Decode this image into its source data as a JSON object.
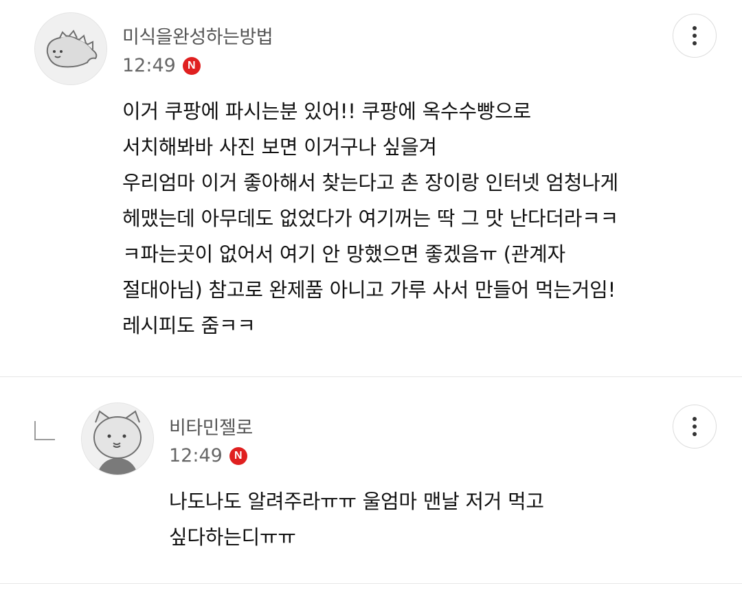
{
  "comments": [
    {
      "nickname": "미식을완성하는방법",
      "time": "12:49",
      "badge": "N",
      "avatar_icon": "dinosaur-avatar-icon",
      "lines": [
        "이거 쿠팡에 파시는분 있어!! 쿠팡에 옥수수빵으로",
        "서치해봐바 사진 보면 이거구나 싶을겨",
        "우리엄마 이거 좋아해서 찾는다고 촌 장이랑 인터넷 엄청나게",
        "헤맸는데 아무데도 없었다가 여기꺼는 딱 그 맛 난다더라ㅋㅋ",
        "ㅋ파는곳이 없어서 여기 안 망했으면 좋겠음ㅠ (관계자",
        "절대아님) 참고로 완제품 아니고 가루 사서 만들어 먹는거임!",
        "레시피도 줌ㅋㅋ"
      ]
    },
    {
      "nickname": "비타민젤로",
      "time": "12:49",
      "badge": "N",
      "avatar_icon": "cat-avatar-icon",
      "is_reply": true,
      "lines": [
        "나도나도 알려주라ㅠㅠ 울엄마 맨날 저거 먹고",
        "싶다하는디ㅠㅠ"
      ]
    }
  ],
  "colors": {
    "badge": "#e02020",
    "divider": "#e6e6e6",
    "nickname": "#555555"
  }
}
